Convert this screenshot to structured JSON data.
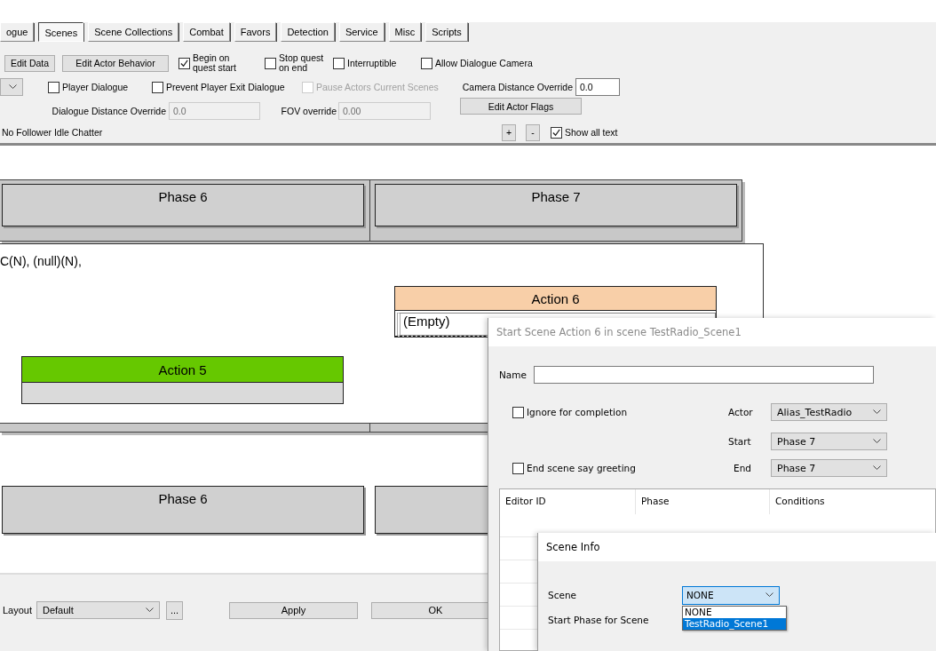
{
  "tabs": [
    {
      "label": "ogue",
      "selected": false
    },
    {
      "label": "Scenes",
      "selected": true
    },
    {
      "label": "Scene Collections",
      "selected": false
    },
    {
      "label": "Combat",
      "selected": false
    },
    {
      "label": "Favors",
      "selected": false
    },
    {
      "label": "Detection",
      "selected": false
    },
    {
      "label": "Service",
      "selected": false
    },
    {
      "label": "Misc",
      "selected": false
    },
    {
      "label": "Scripts",
      "selected": false
    }
  ],
  "toolbar": {
    "rows": [
      {
        "items": [
          {
            "kind": "button",
            "label": "Edit Data"
          },
          {
            "kind": "button",
            "label": "Edit Actor Behavior"
          },
          {
            "kind": "checkbox",
            "label": "Begin on quest start",
            "checked": true,
            "disabled": false
          },
          {
            "kind": "checkbox",
            "label": "Stop quest on end",
            "checked": false,
            "disabled": false
          },
          {
            "kind": "checkbox",
            "label": "Interruptible",
            "checked": false,
            "disabled": false
          },
          {
            "kind": "checkbox",
            "label": "Allow Dialogue Camera",
            "checked": false,
            "disabled": false
          }
        ]
      },
      {
        "items": [
          {
            "kind": "dropdown"
          },
          {
            "kind": "checkbox",
            "label": "Player Dialogue",
            "checked": false,
            "disabled": false
          },
          {
            "kind": "checkbox",
            "label": "Prevent Player Exit Dialogue",
            "checked": false,
            "disabled": false
          },
          {
            "kind": "checkbox",
            "label": "Pause Actors Current Scenes",
            "checked": false,
            "disabled": true
          },
          {
            "kind": "label",
            "label": "Camera Distance Override"
          },
          {
            "kind": "field",
            "value": "0.0",
            "disabled": false
          }
        ]
      },
      {
        "items": [
          {
            "kind": "label",
            "label": "Dialogue Distance Override"
          },
          {
            "kind": "field",
            "value": "0.0",
            "disabled": true
          },
          {
            "kind": "label",
            "label": "FOV override"
          },
          {
            "kind": "field",
            "value": "0.00",
            "disabled": true
          },
          {
            "kind": "button",
            "label": "Edit Actor Flags"
          }
        ]
      },
      {
        "items": [
          {
            "kind": "text",
            "label": "No Follower Idle Chatter"
          },
          {
            "kind": "button",
            "label": "+"
          },
          {
            "kind": "button",
            "label": "-"
          },
          {
            "kind": "checkbox",
            "label": "Show all text",
            "checked": true,
            "disabled": false
          }
        ]
      }
    ]
  },
  "canvas": {
    "phases": [
      {
        "label": "Phase 6"
      },
      {
        "label": "Phase 7"
      }
    ],
    "scene_text": "C(N), (null)(N),",
    "actions": [
      {
        "label": "Action 6",
        "color": "#f8cfa8",
        "content": "(Empty)"
      },
      {
        "label": "Action 5",
        "color": "#66c800"
      }
    ],
    "lower_phases": [
      {
        "label": "Phase 6"
      }
    ]
  },
  "bottom_bar": {
    "layout_label": "Layout",
    "layout_value": "Default",
    "more_button": "...",
    "apply_button": "Apply",
    "ok_button": "OK"
  },
  "action_dialog": {
    "title": "Start Scene Action 6 in scene TestRadio_Scene1",
    "active": false,
    "name_label": "Name",
    "ignore_checkbox": {
      "label": "Ignore for completion",
      "checked": false
    },
    "greeting_checkbox": {
      "label": "End scene say greeting",
      "checked": false
    },
    "actor_label": "Actor",
    "actor_value": "Alias_TestRadio",
    "start_label": "Start",
    "start_value": "Phase 7",
    "end_label": "End",
    "end_value": "Phase 7",
    "columns": [
      "Editor ID",
      "Phase",
      "Conditions"
    ]
  },
  "scene_dialog": {
    "title": "Scene Info",
    "active": true,
    "scene_label": "Scene",
    "scene_value": "NONE",
    "start_phase_label": "Start Phase for Scene",
    "options": [
      {
        "label": "NONE",
        "selected": false
      },
      {
        "label": "TestRadio_Scene1",
        "selected": true
      }
    ]
  }
}
